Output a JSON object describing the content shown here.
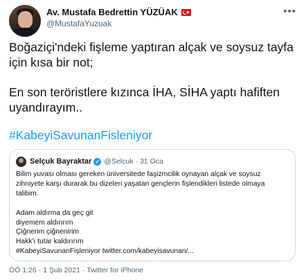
{
  "author": {
    "display_name": "Av. Mustafa Bedrettin YÜZÜAK",
    "handle": "@MustafaYuzuak"
  },
  "icons": {
    "avatar": "profile-photo",
    "flag": "turkey-flag-icon",
    "more": "more-options-icon",
    "verified": "verified-badge-icon"
  },
  "tweet": {
    "line1": "Boğaziçi'ndeki fişleme yaptıran alçak ve soysuz tayfa",
    "line2": "için kısa bir not;",
    "line3": "En son teröristlere kızınca İHA, SİHA yaptı hafiften",
    "line4": "uyandırayım..",
    "hashtag": "#KabeyiSavunanFisleniyor"
  },
  "quote": {
    "name": "Selçuk Bayraktar",
    "handle": "@Selcuk",
    "separator": "·",
    "date": "31 Oca",
    "lines": [
      "Bilim yuvası olması gereken üniversitede faşizmcilik oynayan alçak ve soysuz",
      "zihniyete karşı durarak bu dizeleri yaşatan gençlerin fişlendikleri listede olmaya",
      "talibim.",
      "",
      "Adam aldırma da geç git",
      "diyemem aldırırım",
      "Çiğnerim çiğnenirim",
      "Hakk'ı tutar kaldırırım",
      "#KabeyiSavunanFişleniyor twitter.com/kabeyisavunan/..."
    ]
  },
  "footer": {
    "time": "ÖÖ 1:26",
    "separator": "·",
    "date": "1 Şub 2021",
    "source": "Twitter for iPhone"
  },
  "colors": {
    "text": "#0f1419",
    "secondary": "#536471",
    "link": "#1d9bf0",
    "border": "#cfd9de"
  }
}
